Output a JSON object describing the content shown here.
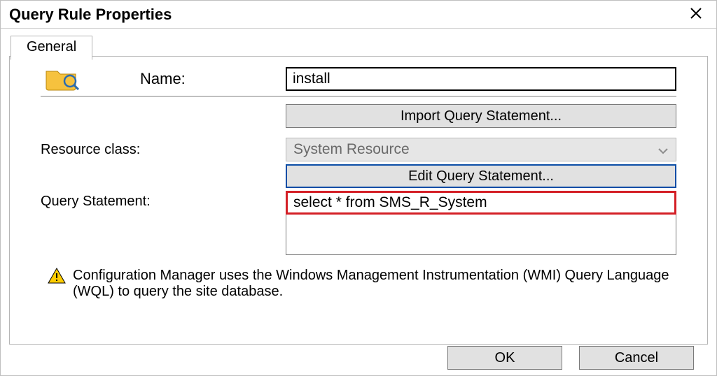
{
  "window": {
    "title": "Query Rule Properties"
  },
  "tab": {
    "label": "General"
  },
  "row_name": {
    "label": "Name:",
    "value": "install"
  },
  "buttons": {
    "import": "Import Query Statement...",
    "edit": "Edit Query Statement...",
    "ok": "OK",
    "cancel": "Cancel"
  },
  "row_resource": {
    "label": "Resource class:",
    "value": "System Resource"
  },
  "row_query": {
    "label": "Query Statement:",
    "value": "select *  from  SMS_R_System"
  },
  "info": {
    "text": "Configuration Manager uses the Windows Management Instrumentation (WMI) Query Language (WQL) to query the site database."
  }
}
